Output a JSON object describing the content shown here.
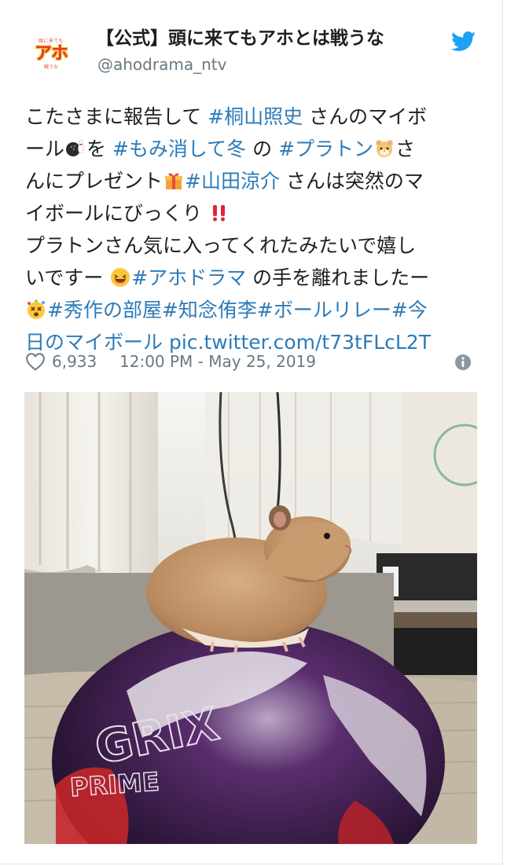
{
  "account": {
    "display_name": "【公式】頭に来てもアホとは戦うな",
    "handle": "@ahodrama_ntv",
    "avatar_text_main": "アホ",
    "avatar_text_top": "頭に来ても",
    "avatar_text_bottom": "戦うな"
  },
  "tweet": {
    "lines": [
      [
        {
          "t": "text",
          "v": "こたさまに報告して "
        },
        {
          "t": "tag",
          "v": "#桐山照史"
        },
        {
          "t": "text",
          "v": " さんのマイボ"
        }
      ],
      [
        {
          "t": "text",
          "v": "ール"
        },
        {
          "t": "emoji",
          "v": "bowling-icon"
        },
        {
          "t": "text",
          "v": "を "
        },
        {
          "t": "tag",
          "v": "#もみ消して冬"
        },
        {
          "t": "text",
          "v": " の "
        },
        {
          "t": "tag",
          "v": "#プラトン"
        },
        {
          "t": "emoji",
          "v": "hamster-icon"
        },
        {
          "t": "text",
          "v": "さ"
        }
      ],
      [
        {
          "t": "text",
          "v": "んにプレゼント"
        },
        {
          "t": "emoji",
          "v": "gift-icon"
        },
        {
          "t": "tag",
          "v": "#山田涼介"
        },
        {
          "t": "text",
          "v": " さんは突然のマ"
        }
      ],
      [
        {
          "t": "text",
          "v": "イボールにびっくり "
        },
        {
          "t": "emoji",
          "v": "double-exclamation-icon"
        }
      ],
      [
        {
          "t": "text",
          "v": "プラトンさん気に入ってくれたみたいで嬉し"
        }
      ],
      [
        {
          "t": "text",
          "v": "いですー "
        },
        {
          "t": "emoji",
          "v": "laughing-face-icon"
        },
        {
          "t": "tag",
          "v": "#アホドラマ"
        },
        {
          "t": "text",
          "v": " の手を離れましたー"
        }
      ],
      [
        {
          "t": "emoji",
          "v": "dizzy-face-icon"
        },
        {
          "t": "tag",
          "v": "#秀作の部屋#知念侑李#ボールリレー#今"
        }
      ],
      [
        {
          "t": "tag",
          "v": "日のマイボール"
        },
        {
          "t": "text",
          "v": " "
        },
        {
          "t": "link",
          "v": "pic.twitter.com/t73tFLcL2T"
        }
      ]
    ],
    "like_count": "6,933",
    "timestamp": "12:00 PM - May 25, 2019"
  },
  "icons": {
    "bird": "twitter-bird-icon",
    "heart": "heart-icon",
    "info": "info-icon"
  },
  "colors": {
    "link": "#2b7bb9",
    "meta": "#697882",
    "text": "#1c2022",
    "bird": "#1da1f2"
  },
  "media": {
    "ball_text_1": "GRIX",
    "ball_text_2": "PRIME"
  }
}
